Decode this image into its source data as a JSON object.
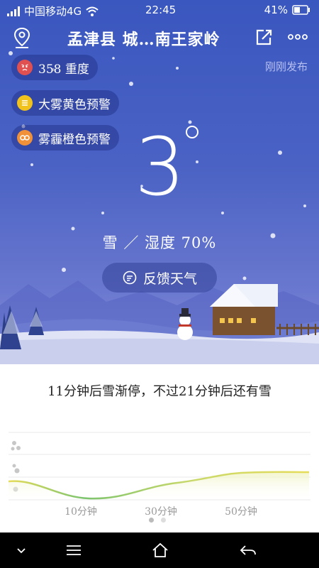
{
  "status": {
    "carrier": "中国移动4G",
    "time": "22:45",
    "battery": "41%"
  },
  "header": {
    "location": "孟津县 城…南王家岭",
    "published": "刚刚发布"
  },
  "badges": [
    {
      "label": "358 重度",
      "color": "#e05050"
    },
    {
      "label": "大雾黄色预警",
      "color": "#f2c21c"
    },
    {
      "label": "雾霾橙色预警",
      "color": "#f0913a"
    }
  ],
  "weather": {
    "temperature": "3",
    "condition": "雪 ／ 湿度 70%",
    "feedback_label": "反馈天气"
  },
  "forecast": {
    "summary": "11分钟后雪渐停，不过21分钟后还有雪",
    "x_labels": [
      "10分钟",
      "30分钟",
      "50分钟"
    ]
  },
  "chart_data": {
    "type": "line",
    "x_ticks": [
      "10分钟",
      "30分钟",
      "50分钟"
    ],
    "y_levels": [
      "heavy",
      "moderate",
      "light"
    ],
    "line_color_start": "#7cc46e",
    "line_color_end": "#e6dc5a"
  },
  "colors": {
    "sky_top": "#3a57bf",
    "sky_bottom": "#8b92d8"
  },
  "icons": {
    "location": "location-pin-icon",
    "share": "share-icon",
    "more": "more-icon"
  }
}
